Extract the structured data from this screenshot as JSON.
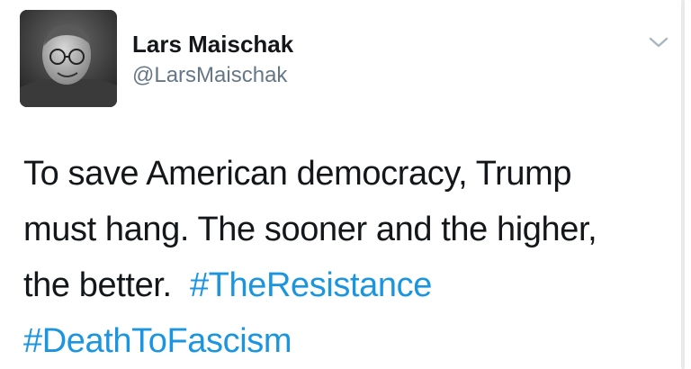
{
  "user": {
    "display_name": "Lars Maischak",
    "handle": "@LarsMaischak",
    "avatar_alt": "profile photo of man with glasses"
  },
  "menu": {
    "icon": "chevron-down-icon"
  },
  "tweet": {
    "line1": "To save American democracy, Trump",
    "line2": "must hang.  The sooner and the higher,",
    "line3_text": "the better.",
    "hashtag1": "#TheResistance",
    "hashtag2": "#DeathToFascism"
  },
  "colors": {
    "text": "#14171a",
    "handle": "#657786",
    "link": "#1b95e0",
    "caret": "#aab8c2"
  }
}
